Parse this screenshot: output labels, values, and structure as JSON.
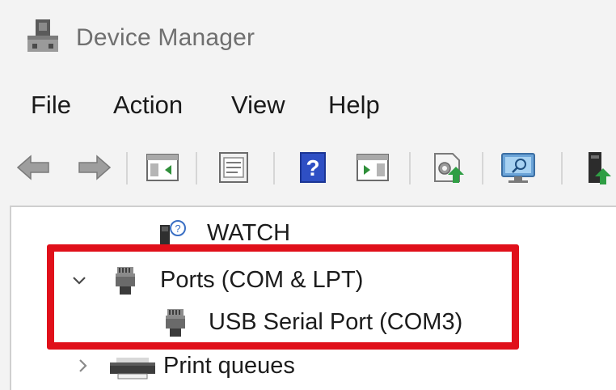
{
  "window": {
    "title": "Device Manager"
  },
  "menu": {
    "items": [
      "File",
      "Action",
      "View",
      "Help"
    ]
  },
  "toolbar": {
    "buttons": [
      {
        "icon": "back-arrow-icon"
      },
      {
        "icon": "forward-arrow-icon"
      },
      {
        "icon": "show-hide-console-tree-icon"
      },
      {
        "icon": "properties-icon"
      },
      {
        "icon": "help-icon",
        "glyph": "?"
      },
      {
        "icon": "action-pane-icon"
      },
      {
        "icon": "update-driver-icon"
      },
      {
        "icon": "scan-hardware-icon"
      },
      {
        "icon": "device-icon"
      }
    ]
  },
  "tree": {
    "items": [
      {
        "label": "WATCH",
        "icon": "watch-device-icon",
        "expanded": null
      },
      {
        "label": "Ports (COM & LPT)",
        "icon": "port-icon",
        "expanded": true
      },
      {
        "label": "USB Serial Port (COM3)",
        "icon": "port-icon",
        "expanded": null
      },
      {
        "label": "Print queues",
        "icon": "printer-icon",
        "expanded": false
      }
    ]
  },
  "annotation": {
    "color": "#e0101a"
  }
}
